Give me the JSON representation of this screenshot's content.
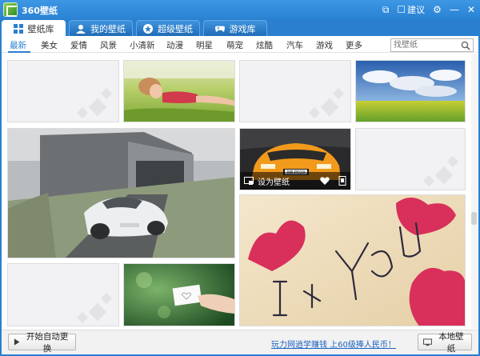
{
  "app": {
    "title": "360壁纸"
  },
  "titlebar": {
    "feedback_label": "建议",
    "minimize_glyph": "—",
    "close_glyph": "✕"
  },
  "tabs": [
    {
      "label": "壁纸库",
      "icon": "grid-icon",
      "active": true
    },
    {
      "label": "我的壁纸",
      "icon": "user-icon",
      "active": false
    },
    {
      "label": "超级壁纸",
      "icon": "star-icon",
      "active": false
    },
    {
      "label": "游戏库",
      "icon": "gamepad-icon",
      "active": false
    }
  ],
  "categories": [
    "最新",
    "美女",
    "爱情",
    "风景",
    "小清新",
    "动漫",
    "明星",
    "萌宠",
    "炫酷",
    "汽车",
    "游戏",
    "更多"
  ],
  "search": {
    "placeholder": "找壁纸"
  },
  "tiles": {
    "car_overlay_label": "设为壁纸",
    "car_plate": "NB·PO19"
  },
  "bottom": {
    "auto_change_label": "开始自动更换",
    "promo_link": "玩力网逍学赚钱 上60级捧人民币！",
    "local_wallpaper_label": "本地壁纸"
  },
  "colors": {
    "brand_blue": "#2a7fcf",
    "link_blue": "#1d62c0"
  }
}
